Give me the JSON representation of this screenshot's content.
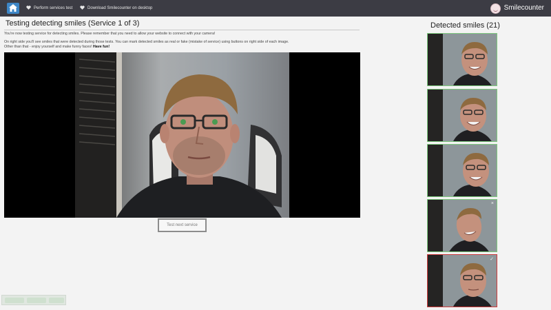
{
  "nav": {
    "home_icon": "home-icon",
    "items": [
      {
        "label": "Perform services test",
        "icon": "heart-icon"
      },
      {
        "label": "Download Smilecounter on desktop",
        "icon": "heart-icon"
      }
    ],
    "brand": "Smilecounter"
  },
  "main": {
    "title": "Testing detecting smiles (Service 1 of 3)",
    "intro_1": "You're now testing service for detecting smiles. Please remember that you need to allow your website to connect with your camera!",
    "intro_2": "On right side you'll see smiles that were detected during those tests. You can mark detected smiles as real or fake (mistake of service) using buttons on right side of each image.",
    "intro_3": "Other than that - enjoy yourself and make funny faces!",
    "intro_3_bold": "Have fun!",
    "next_button": "Test next service"
  },
  "sidebar": {
    "title": "Detected smiles (21)",
    "thumbs": [
      {
        "status": "real"
      },
      {
        "status": "real"
      },
      {
        "status": "real"
      },
      {
        "status": "real",
        "mark": "×"
      },
      {
        "status": "fake",
        "mark": "✓"
      }
    ]
  },
  "colors": {
    "nav_bg": "#3c3c44",
    "home_blue": "#3d86c6",
    "real_border": "#7cc97c",
    "fake_border": "#cf3b3b"
  }
}
